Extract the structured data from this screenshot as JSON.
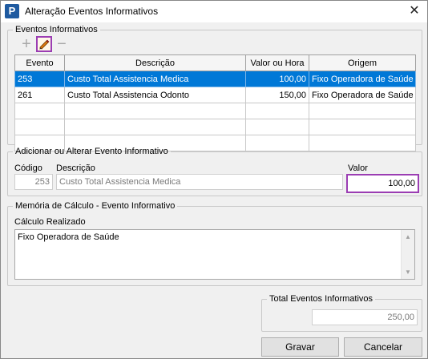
{
  "window": {
    "title": "Alteração Eventos Informativos",
    "close_symbol": "✕",
    "app_icon_letter": "P"
  },
  "events": {
    "legend": "Eventos Informativos",
    "toolbar": {
      "add_symbol": "+",
      "edit_symbol": "✎",
      "remove_symbol": "−"
    },
    "columns": [
      "Evento",
      "Descrição",
      "Valor ou Hora",
      "Origem"
    ],
    "rows": [
      {
        "evento": "253",
        "descricao": "Custo Total Assistencia Medica",
        "valor": "100,00",
        "origem": "Fixo Operadora de Saúde",
        "selected": true
      },
      {
        "evento": "261",
        "descricao": "Custo Total Assistencia Odonto",
        "valor": "150,00",
        "origem": "Fixo Operadora de Saúde",
        "selected": false
      }
    ]
  },
  "edit": {
    "legend": "Adicionar ou Alterar Evento Informativo",
    "codigo_label": "Código",
    "descricao_label": "Descrição",
    "valor_label": "Valor",
    "codigo_value": "253",
    "descricao_value": "Custo Total Assistencia Medica",
    "valor_value": "100,00"
  },
  "memoria": {
    "legend": "Memória de Cálculo - Evento Informativo",
    "calc_label": "Cálculo Realizado",
    "calc_text": "Fixo Operadora de Saúde"
  },
  "total": {
    "legend": "Total Eventos Informativos",
    "value": "250,00"
  },
  "buttons": {
    "gravar": "Gravar",
    "cancelar": "Cancelar"
  },
  "colors": {
    "selection": "#0078d7",
    "highlight_border": "#9b3db3"
  }
}
